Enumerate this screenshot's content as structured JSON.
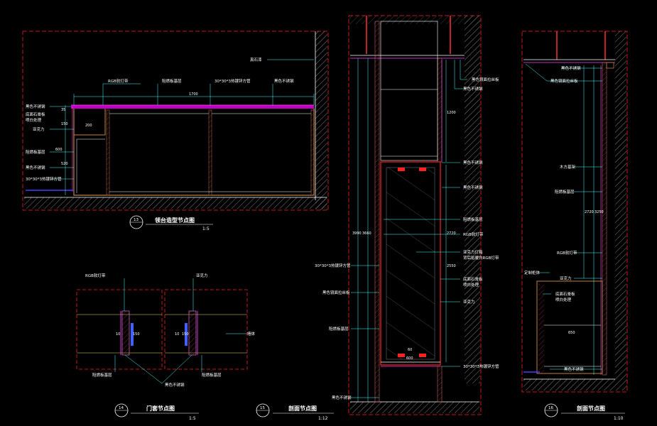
{
  "views": {
    "v13": {
      "number": "13",
      "title": "领台造型节点图",
      "scale": "1:5"
    },
    "v14": {
      "number": "14",
      "title": "门套节点图",
      "scale": "1:5"
    },
    "v15": {
      "number": "15",
      "title": "剖面节点图",
      "scale": "1:12"
    },
    "v16": {
      "number": "16",
      "title": "剖面节点图",
      "scale": "1:10"
    }
  },
  "labels_13": {
    "stone": "真石漆",
    "led": "RGB软灯带",
    "board1": "阻燃板基层",
    "tube": "30*30*3热镀锌方管",
    "steel_top": "黑色不锈钢",
    "steel_left": "黑色不锈钢",
    "marble": "底面石膏板",
    "paint": "喷白处理",
    "acrylic": "亚克力",
    "board2": "阻燃板基层",
    "steel_left2": "黑色不锈钢",
    "tube2": "30*30*3热镀锌方管"
  },
  "dims_13": {
    "width": "1700",
    "d1": "150",
    "d2": "520",
    "d3": "200",
    "d4": "600",
    "d5": "35"
  },
  "labels_14": {
    "led": "RGB软灯带",
    "acrylic": "亚克力",
    "wall": "墙体",
    "board": "阻燃板基层",
    "steel": "黑色不锈钢"
  },
  "dims_14": {
    "a": "10",
    "b": "150",
    "c": "10",
    "d": "150"
  },
  "labels_15": {
    "mirror_top": "黑色镜面拉丝板",
    "steel1": "黑色不锈钢",
    "steel2": "黑色不锈钢",
    "steel3": "黑色不锈钢",
    "board": "阻燃板基层",
    "led": "RGB软灯带",
    "acrylic_light": "亚克力灯箱",
    "acrylic_sub": "背后贴暖白RGB灯带",
    "tube_left": "30*30*3热镀锌方管",
    "marble": "底面石膏板",
    "paint": "喷白处理",
    "mirror_left": "黑色镜面拉丝板",
    "acrylic": "亚克力",
    "board_left": "阻燃板基层",
    "tube_bottom": "30*30*3热镀锌方管",
    "steel_bottom": "黑色不锈钢"
  },
  "dims_15": {
    "h1": "3660",
    "h2": "3990",
    "h3": "1200",
    "h4": "2550",
    "h5": "2720",
    "w1": "600",
    "w2": "60"
  },
  "labels_16": {
    "steel_top": "黑色不锈钢",
    "mirror": "黑色镜面拉丝板",
    "wood": "木方基架",
    "board": "阻燃板基层",
    "led": "RGB软灯带",
    "cabinet": "定制柜体",
    "acrylic": "亚克力",
    "marble": "底面石膏板",
    "paint": "喷白处理",
    "steel_bottom": "黑色不锈钢"
  },
  "dims_16": {
    "h1": "2720",
    "h2": "3250",
    "h3": "650"
  }
}
